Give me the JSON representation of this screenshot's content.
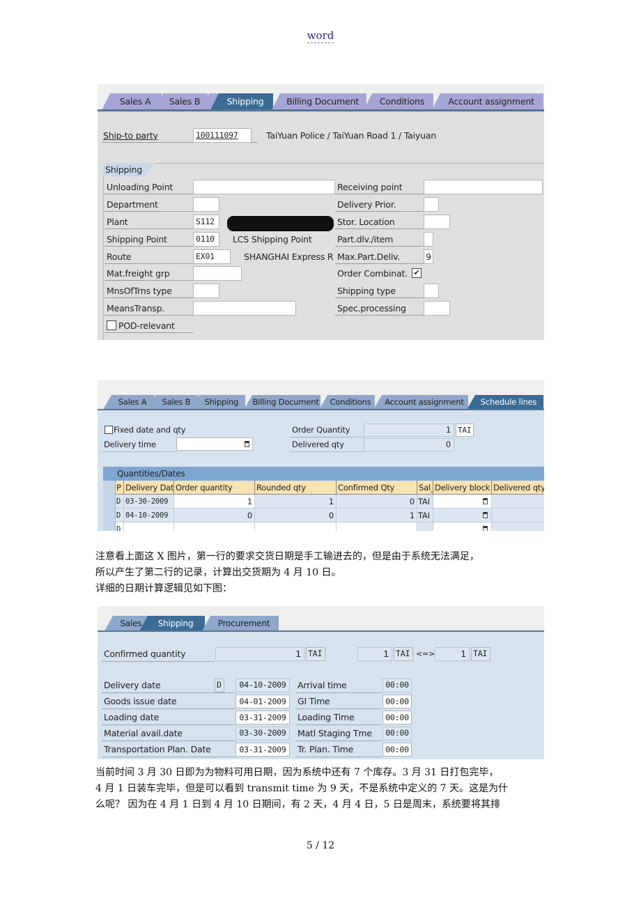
{
  "header": {
    "word_label": "word"
  },
  "shot1": {
    "tabs": [
      "Sales A",
      "Sales B",
      "Shipping",
      "Billing Document",
      "Conditions",
      "Account assignment"
    ],
    "active_tab": "Shipping",
    "ship_to": {
      "label": "Ship-to party",
      "value": "100111097",
      "description": "TaiYuan Police / TaiYuan Road 1 / Taiyuan"
    },
    "group_title": "Shipping",
    "left_fields": [
      {
        "label": "Unloading Point",
        "value": ""
      },
      {
        "label": "Department",
        "value": ""
      },
      {
        "label": "Plant",
        "value": "S112",
        "description": "[redacted]"
      },
      {
        "label": "Shipping Point",
        "value": "0110",
        "description": "LCS Shipping Point"
      },
      {
        "label": "Route",
        "value": "EX01",
        "description": "SHANGHAI Express R"
      },
      {
        "label": "Mat.freight grp",
        "value": ""
      },
      {
        "label": "MnsOfTrns type",
        "value": ""
      },
      {
        "label": "MeansTransp.",
        "value": ""
      }
    ],
    "pod_relevant": {
      "label": "POD-relevant",
      "checked": false
    },
    "right_fields": [
      {
        "label": "Receiving point",
        "value": ""
      },
      {
        "label": "Delivery Prior.",
        "value": ""
      },
      {
        "label": "Stor. Location",
        "value": ""
      },
      {
        "label": "Part.dlv./item",
        "value": ""
      },
      {
        "label": "Max.Part.Deliv.",
        "value": "9"
      },
      {
        "label": "Order Combinat.",
        "checked": true
      },
      {
        "label": "Shipping type",
        "value": ""
      },
      {
        "label": "Spec.processing",
        "value": ""
      }
    ]
  },
  "shot2": {
    "tabs": [
      "Sales A",
      "Sales B",
      "Shipping",
      "Billing Document",
      "Conditions",
      "Account assignment",
      "Schedule lines"
    ],
    "active_tab": "Schedule lines",
    "fixed_date": {
      "label": "Fixed date and qty",
      "checked": false
    },
    "delivery_time": {
      "label": "Delivery time",
      "value": ""
    },
    "order_quantity": {
      "label": "Order Quantity",
      "value": "1",
      "unit": "TAI"
    },
    "delivered_qty": {
      "label": "Delivered qty",
      "value": "0"
    },
    "grid_title": "Quantities/Dates",
    "columns": [
      "P",
      "Delivery Date",
      "Order quantity",
      "Rounded qty",
      "Confirmed Qty",
      "Sal_",
      "Delivery block",
      "Delivered qty"
    ],
    "rows": [
      {
        "p": "D",
        "date": "03-30-2009",
        "order_qty": "1",
        "rounded": "1",
        "confirmed": "0",
        "unit": "TAI",
        "block": "",
        "delivered": ""
      },
      {
        "p": "D",
        "date": "04-10-2009",
        "order_qty": "0",
        "rounded": "0",
        "confirmed": "1",
        "unit": "TAI",
        "block": "",
        "delivered": ""
      },
      {
        "p": "D",
        "date": "",
        "order_qty": "",
        "rounded": "",
        "confirmed": "",
        "unit": "",
        "block": "",
        "delivered": ""
      }
    ]
  },
  "para1": {
    "line1": "注意看上面这 X 图片，第一行的要求交货日期是手工输进去的，但是由于系统无法满足，",
    "line2": "所以产生了第二行的记录，计算出交货期为 4 月 10 日。",
    "line3": "详细的日期计算逻辑见如下图："
  },
  "shot3": {
    "tabs": [
      "Sales",
      "Shipping",
      "Procurement"
    ],
    "active_tab": "Shipping",
    "confirmed_quantity": {
      "label": "Confirmed quantity",
      "value": "1",
      "unit": "TAI",
      "value2": "1",
      "unit2": "TAI",
      "arrow": "<=>",
      "value3": "1",
      "unit3": "TAI"
    },
    "dates": [
      {
        "label": "Delivery date",
        "flag": "D",
        "date": "04-10-2009",
        "time_label": "Arrival time",
        "time": "00:00"
      },
      {
        "label": "Goods issue date",
        "date": "04-01-2009",
        "time_label": "GI Time",
        "time": "00:00"
      },
      {
        "label": "Loading date",
        "date": "03-31-2009",
        "time_label": "Loading Time",
        "time": "00:00"
      },
      {
        "label": "Material avail.date",
        "date": "03-30-2009",
        "time_label": "Matl Staging Tme",
        "time": "00:00"
      },
      {
        "label": "Transportation Plan. Date",
        "date": "03-31-2009",
        "time_label": "Tr. Plan. Time",
        "time": "00:00"
      }
    ]
  },
  "para2": {
    "line1": "当前时间 3 月 30 日即为为物料可用日期，因为系统中还有 7 个库存。3 月 31 日打包完毕，",
    "line2": "4 月 1 日装车完毕，但是可以看到 transmit time 为 9 天，不是系统中定义的 7 天。这是为什",
    "line3": "么呢？ 因为在 4 月 1 日到 4 月 10 日期间，有 2 天，4 月 4 日，5 日是周末，系统要将其排"
  },
  "footer": {
    "page": "5 / 12"
  }
}
